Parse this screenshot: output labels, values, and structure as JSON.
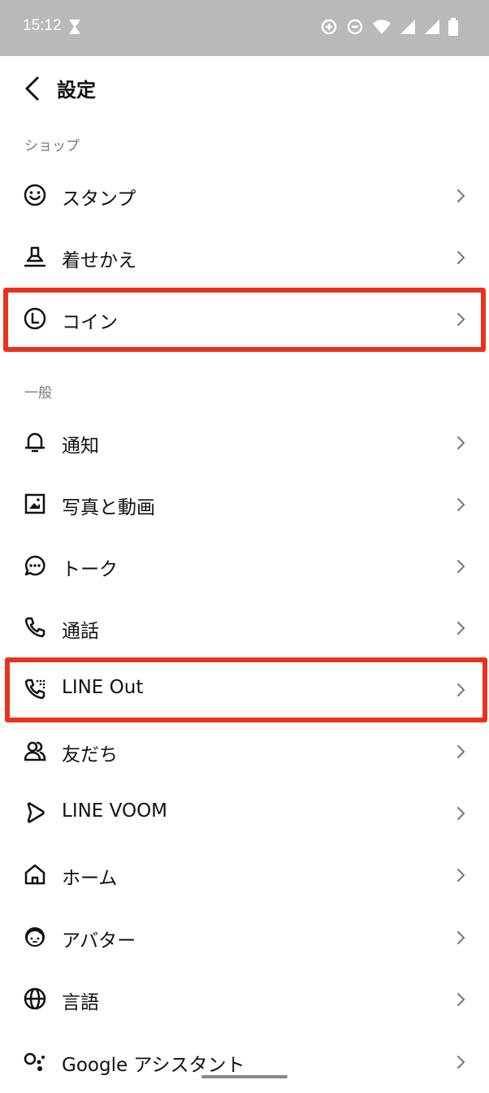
{
  "status_bar": {
    "time": "15:12"
  },
  "header": {
    "title": "設定"
  },
  "sections": [
    {
      "title": "ショップ",
      "items": [
        {
          "label": "スタンプ",
          "icon": "smile-icon"
        },
        {
          "label": "着せかえ",
          "icon": "stamp-brush-icon"
        },
        {
          "label": "コイン",
          "icon": "coin-icon"
        }
      ]
    },
    {
      "title": "一般",
      "items": [
        {
          "label": "通知",
          "icon": "bell-icon"
        },
        {
          "label": "写真と動画",
          "icon": "photo-icon"
        },
        {
          "label": "トーク",
          "icon": "chat-bubble-icon"
        },
        {
          "label": "通話",
          "icon": "phone-icon"
        },
        {
          "label": "LINE Out",
          "icon": "phone-dial-icon"
        },
        {
          "label": "友だち",
          "icon": "friends-icon"
        },
        {
          "label": "LINE VOOM",
          "icon": "voom-icon"
        },
        {
          "label": "ホーム",
          "icon": "home-icon"
        },
        {
          "label": "アバター",
          "icon": "avatar-icon"
        },
        {
          "label": "言語",
          "icon": "globe-icon"
        },
        {
          "label": "Google アシスタント",
          "icon": "assistant-icon"
        }
      ]
    }
  ],
  "highlight_color": "#e8321c"
}
